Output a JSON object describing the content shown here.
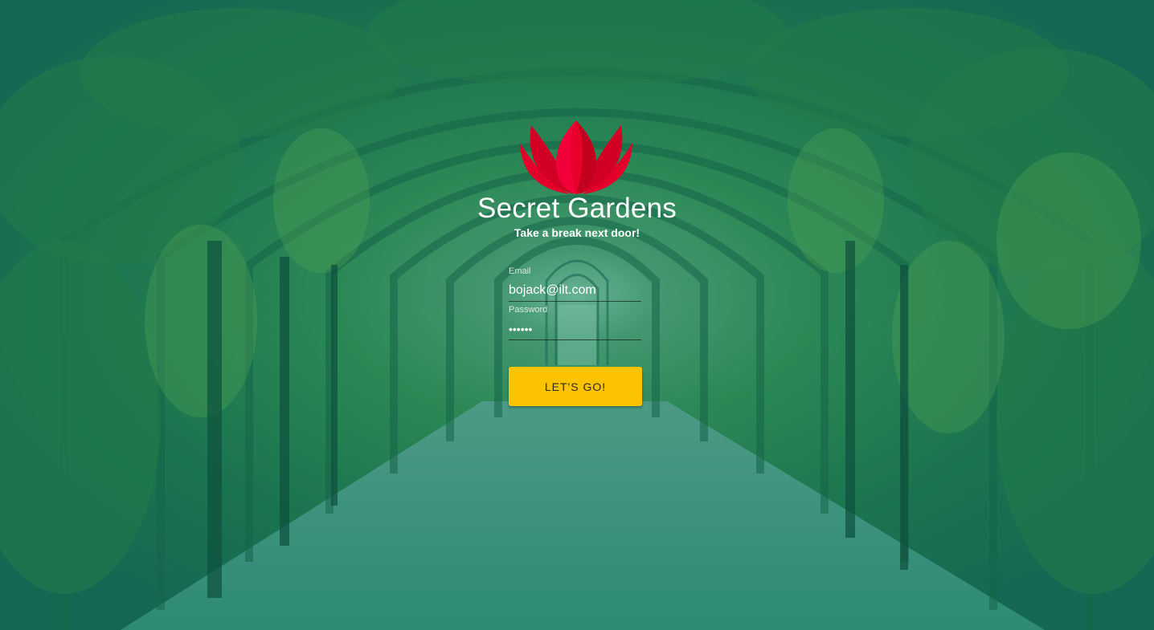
{
  "brand": {
    "name": "Secret Gardens",
    "tagline": "Take a break next door!",
    "logo_color": "#e8002a"
  },
  "form": {
    "email_label": "Email",
    "email_value": "bojack@ilt.com",
    "password_label": "Password",
    "password_value": "••••••",
    "submit_label": "LET'S GO!"
  },
  "colors": {
    "accent": "#fcc400",
    "overlay": "#00806e"
  },
  "background": {
    "icon": "garden-archway-photo"
  }
}
